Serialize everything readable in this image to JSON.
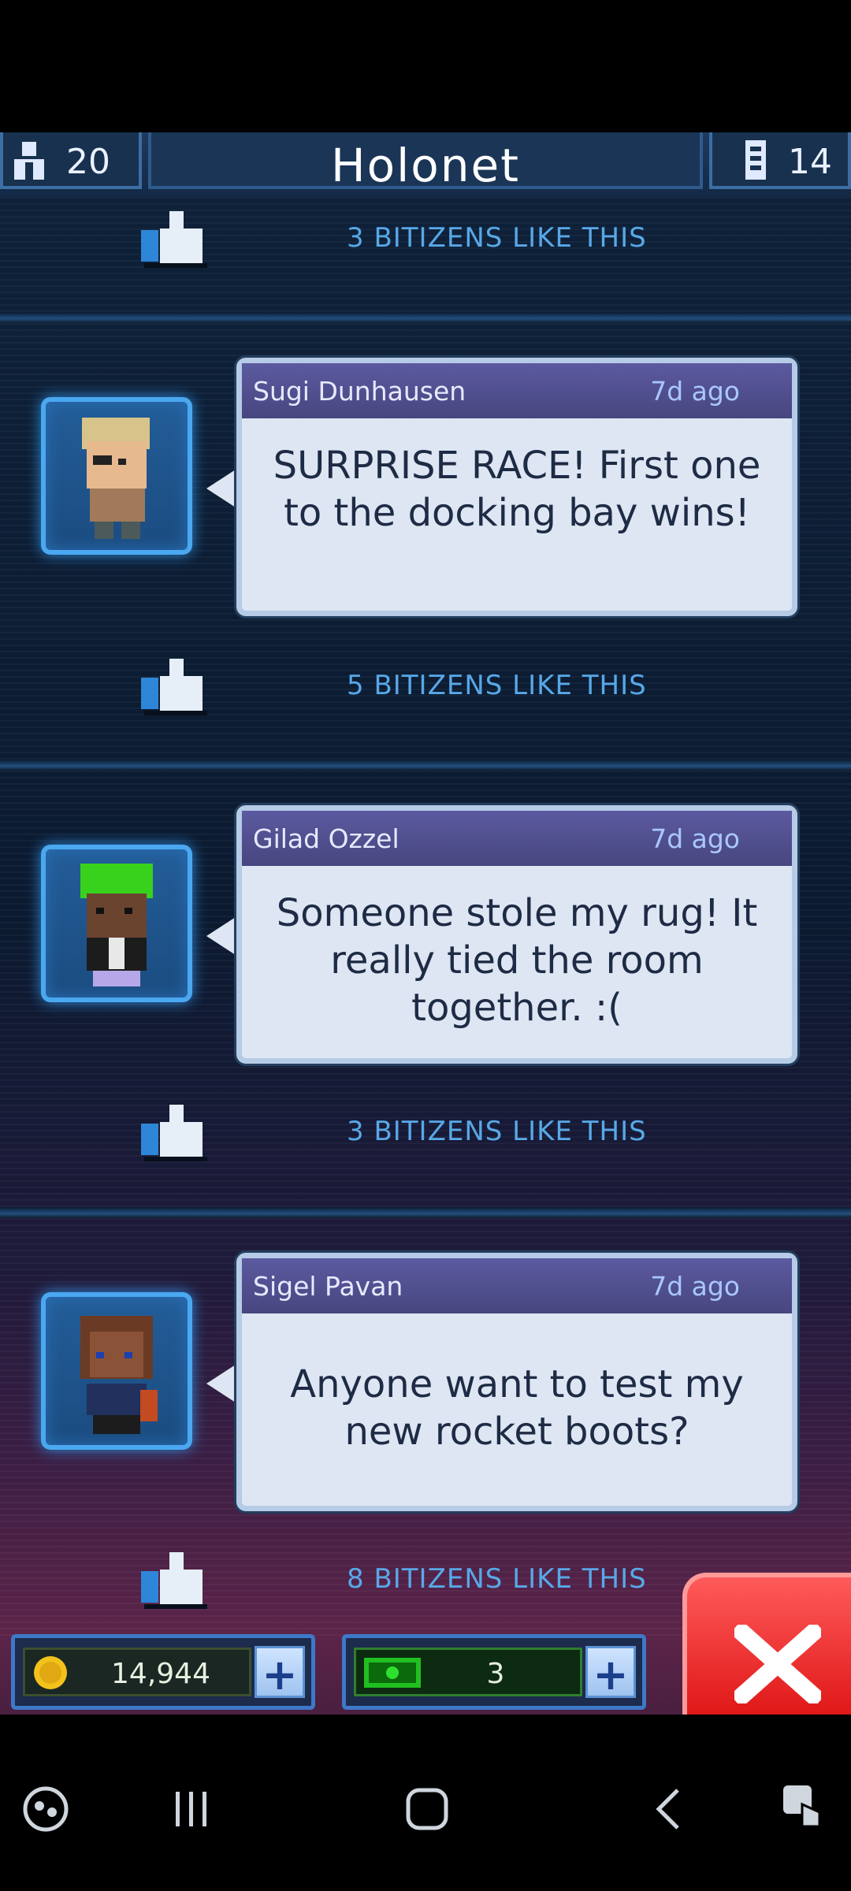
{
  "header": {
    "population": "20",
    "title": "Holonet",
    "floors": "14"
  },
  "posts": [
    {
      "author": "Sugi Dunhausen",
      "time": "7d ago",
      "message": "SURPRISE RACE! First one to the docking bay wins!",
      "likes": "5 BITIZENS LIKE THIS"
    },
    {
      "author": "Gilad Ozzel",
      "time": "7d ago",
      "message": "Someone stole my rug! It really tied the room together. :(",
      "likes": "3 BITIZENS LIKE THIS"
    },
    {
      "author": "Sigel Pavan",
      "time": "7d ago",
      "message": "Anyone want to test my new rocket boots?",
      "likes": "8 BITIZENS LIKE THIS"
    }
  ],
  "top_like": "3 BITIZENS LIKE THIS",
  "bottom": {
    "coins": "14,944",
    "bux": "3"
  },
  "colors": {
    "accent": "#4aa8f0",
    "like_text": "#58a8e8",
    "close_red": "#e01818"
  }
}
